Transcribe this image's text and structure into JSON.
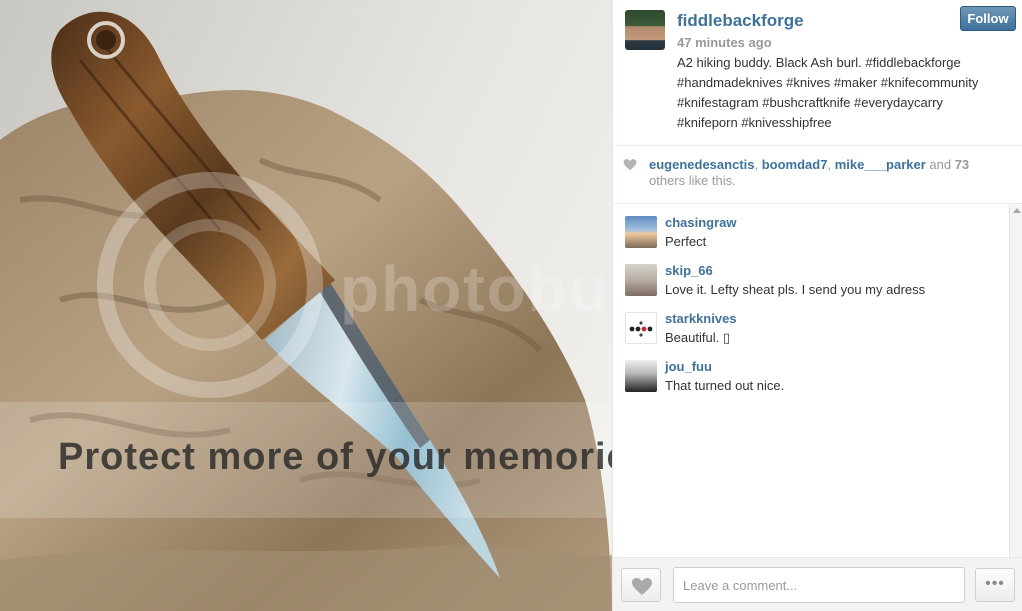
{
  "post": {
    "username": "fiddlebackforge",
    "time": "47 minutes ago",
    "follow_label": "Follow",
    "caption": "A2 hiking buddy. Black Ash burl. #fiddlebackforge #handmadeknives #knives #maker #knifecommunity #knifestagram #bushcraftknife #everydaycarry #knifeporn #knivesshipfree"
  },
  "likes": {
    "users": [
      "eugenedesanctis",
      "boomdad7",
      "mike___parker"
    ],
    "separator": ", ",
    "and": " and ",
    "count": "73",
    "suffix": " others like this."
  },
  "comments": [
    {
      "user": "chasingraw",
      "text": "Perfect"
    },
    {
      "user": "skip_66",
      "text": "Love it. Lefty sheat pls. I send you my adress"
    },
    {
      "user": "starkknives",
      "text": "Beautiful. ▯"
    },
    {
      "user": "jou_fuu",
      "text": "That turned out nice."
    }
  ],
  "footer": {
    "comment_placeholder": "Leave a comment...",
    "more_label": "•••"
  },
  "watermark": {
    "banner": "Protect more of your memories for less!",
    "logo": "photobucket"
  },
  "icons": {
    "heart": "heart-icon",
    "more": "more-options-icon"
  }
}
